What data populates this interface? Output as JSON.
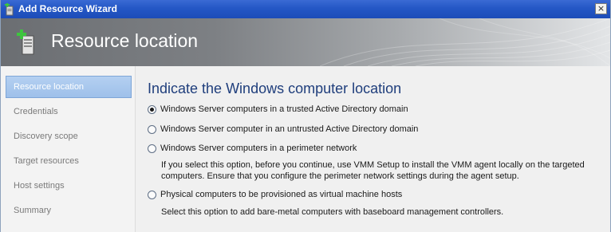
{
  "window": {
    "title": "Add Resource Wizard",
    "close_label": "×"
  },
  "header": {
    "title": "Resource location"
  },
  "nav": {
    "items": [
      {
        "label": "Resource location",
        "selected": true
      },
      {
        "label": "Credentials",
        "selected": false
      },
      {
        "label": "Discovery scope",
        "selected": false
      },
      {
        "label": "Target resources",
        "selected": false
      },
      {
        "label": "Host settings",
        "selected": false
      },
      {
        "label": "Summary",
        "selected": false
      }
    ]
  },
  "main": {
    "heading": "Indicate the Windows computer location",
    "options": [
      {
        "label": "Windows Server computers in a trusted Active Directory domain",
        "checked": true
      },
      {
        "label": "Windows Server computer in an untrusted Active Directory domain",
        "checked": false
      },
      {
        "label": "Windows Server computers in a perimeter network",
        "checked": false,
        "description": [
          "If you select this option, before you continue, use VMM Setup to install the VMM agent locally on the targeted",
          "computers. Ensure that you configure the perimeter network settings during the agent setup."
        ]
      },
      {
        "label": "Physical computers to be provisioned as virtual machine hosts",
        "checked": false,
        "description": [
          "Select this option to add bare-metal computers with baseboard management controllers."
        ]
      }
    ]
  },
  "colors": {
    "titlebar": "#2457c5",
    "heading": "#1f3e7c",
    "nav_selected": "#a9c8ee",
    "nav_text": "#7a7a7a"
  },
  "icons": {
    "app": "add-server-icon",
    "close": "close-icon",
    "header": "add-server-icon"
  }
}
